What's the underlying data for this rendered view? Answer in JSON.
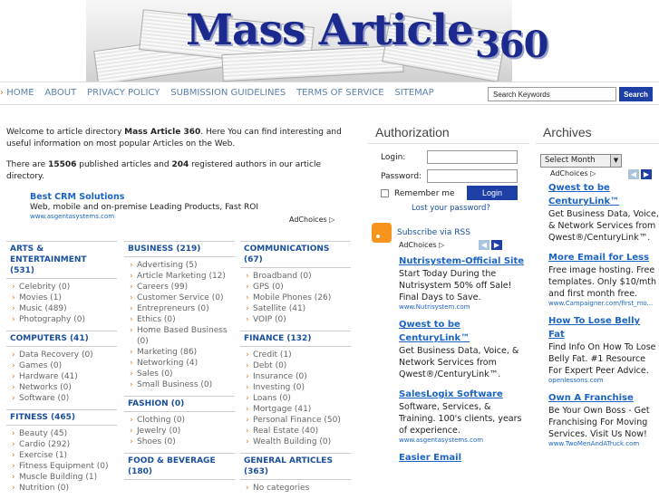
{
  "header": {
    "logo_main": "Mass Article",
    "logo_sub": "360"
  },
  "nav": {
    "items": [
      "HOME",
      "ABOUT",
      "PRIVACY POLICY",
      "SUBMISSION GUIDELINES",
      "TERMS OF SERVICE",
      "SITEMAP"
    ],
    "search_placeholder": "Search Keywords",
    "search_button": "Search"
  },
  "intro": {
    "p1_a": "Welcome to article directory ",
    "p1_site": "Mass Article 360",
    "p1_b": ". Here You can find interesting and useful information on most popular Articles on the Web.",
    "p2_a": "There are ",
    "p2_articles": "15506",
    "p2_b": " published articles and ",
    "p2_authors": "204",
    "p2_c": " registered authors in our article directory."
  },
  "main_ad": {
    "title": "Best CRM Solutions",
    "body": "Web, mobile and on-premise Leading Products, Fast ROI",
    "url": "www.asgentasystems.com",
    "adchoices": "AdChoices ▷"
  },
  "categories": {
    "col1": [
      {
        "title": "ARTS & ENTERTAINMENT (531)",
        "items": [
          "Celebrity (0)",
          "Movies (1)",
          "Music (489)",
          "Photography (0)"
        ]
      },
      {
        "title": "COMPUTERS (41)",
        "items": [
          "Data Recovery (0)",
          "Games (0)",
          "Hardware (41)",
          "Networks (0)",
          "Software (0)"
        ]
      },
      {
        "title": "FITNESS (465)",
        "items": [
          "Beauty (45)",
          "Cardio (292)",
          "Exercise (1)",
          "Fitness Equipment (0)",
          "Muscle Building (1)",
          "Nutrition (0)"
        ]
      }
    ],
    "col2": [
      {
        "title": "BUSINESS (219)",
        "items": [
          "Advertising (5)",
          "Article Marketing (12)",
          "Careers (99)",
          "Customer Service (0)",
          "Entrepreneurs (0)",
          "Ethics (0)",
          "Home Based Business (0)",
          "Marketing (86)",
          "Networking (4)",
          "Sales (0)",
          "Small Business (0)"
        ]
      },
      {
        "title": "FASHION (0)",
        "items": [
          "Clothing (0)",
          "Jewelry (0)",
          "Shoes (0)"
        ]
      },
      {
        "title": "FOOD & BEVERAGE (180)",
        "items": []
      }
    ],
    "col3": [
      {
        "title": "COMMUNICATIONS (67)",
        "items": [
          "Broadband (0)",
          "GPS (0)",
          "Mobile Phones (26)",
          "Satellite (41)",
          "VOIP (0)"
        ]
      },
      {
        "title": "FINANCE (132)",
        "items": [
          "Credit (1)",
          "Debt (0)",
          "Insurance (0)",
          "Investing (0)",
          "Loans (0)",
          "Mortgage (41)",
          "Personal Finance (50)",
          "Real Estate (40)",
          "Wealth Building (0)"
        ]
      },
      {
        "title": "GENERAL ARTICLES (363)",
        "items": [
          "No categories"
        ]
      }
    ]
  },
  "auth": {
    "title": "Authorization",
    "login_label": "Login:",
    "password_label": "Password:",
    "remember_label": "Remember me",
    "login_button": "Login",
    "lost_password": "Lost your password?",
    "rss_label": "Subscribe via RSS",
    "adchoices": "AdChoices ▷",
    "ads": [
      {
        "title": "Nutrisystem-Official Site",
        "body": "Start Today During the Nutrisystem 50% off Sale! Final Days to Save.",
        "url": "www.Nutrisystem.com"
      },
      {
        "title": "Qwest to be CenturyLink™",
        "body": "Get Business Data, Voice, & Network Services from Qwest®/CenturyLink™.",
        "url": ""
      },
      {
        "title": "SalesLogix Software",
        "body": "Software, Services, & Training. 100's clients, years of experience.",
        "url": "www.asgentasystems.com"
      },
      {
        "title": "Easier Email",
        "body": "",
        "url": ""
      }
    ]
  },
  "archives": {
    "title": "Archives",
    "select_value": "Select Month",
    "adchoices": "AdChoices ▷",
    "ads": [
      {
        "title": "Qwest to be CenturyLink™",
        "body": "Get Business Data, Voice, & Network Services from Qwest®/CenturyLink™.",
        "url": ""
      },
      {
        "title": "More Email for Less",
        "body": "Free image hosting. Free templates. Only $10/mth and first month free.",
        "url": "www.Campaigner.com/first_mo..."
      },
      {
        "title": "How To Lose Belly Fat",
        "body": "Find Info On How To Lose Belly Fat. #1 Resource For Expert Peer Advice.",
        "url": "openlessons.com"
      },
      {
        "title": "Own A Franchise",
        "body": "Be Your Own Boss - Get Franchising For Moving Services. Visit Us Now!",
        "url": "www.TwoMenAndATruck.com"
      }
    ]
  }
}
